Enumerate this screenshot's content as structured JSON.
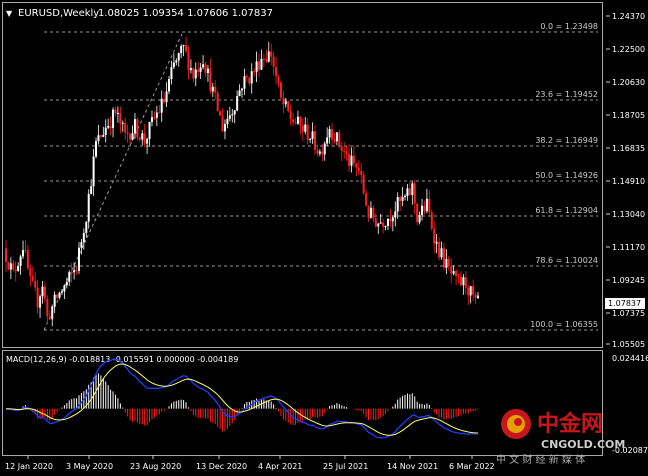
{
  "header": {
    "dropdown_glyph": "▼",
    "symbol": "EURUSD,Weekly",
    "ohlc": "1.08025 1.09354 1.07606 1.07837"
  },
  "price_axis": {
    "labels": [
      "1.24370",
      "1.22500",
      "1.20630",
      "1.18705",
      "1.16835",
      "1.14910",
      "1.13040",
      "1.11170",
      "1.09245",
      "1.07375",
      "1.05505"
    ],
    "current_price": "1.07837"
  },
  "fibonacci": [
    {
      "label": "0.0 = 1.23498"
    },
    {
      "label": "23.6 = 1.19452"
    },
    {
      "label": "38.2 = 1.16949"
    },
    {
      "label": "50.0 = 1.14926"
    },
    {
      "label": "61.8 = 1.12904"
    },
    {
      "label": "78.6 = 1.10024"
    },
    {
      "label": "100.0 = 1.06355"
    }
  ],
  "macd": {
    "label": "MACD(12,26,9) -0.018813 -0.015591 0.000000 -0.004189",
    "axis_top": "0.024416",
    "axis_bottom": "-0.020872"
  },
  "time_axis": [
    "12 Jan 2020",
    "3 May 2020",
    "23 Aug 2020",
    "13 Dec 2020",
    "4 Apr 2021",
    "25 Jul 2021",
    "14 Nov 2021",
    "6 Mar 2022"
  ],
  "watermark": {
    "logo_text": "中金网",
    "domain": "CNGOLD.COM",
    "slogan": "中 文 财 经 新 媒 体"
  },
  "colors": {
    "background": "#000000",
    "bull_candle": "#ffffff",
    "bear_candle": "#ff2020",
    "grid": "#888888",
    "macd_main": "#1e3cff",
    "macd_signal": "#ffff66",
    "logo_red": "#c8161d"
  }
}
